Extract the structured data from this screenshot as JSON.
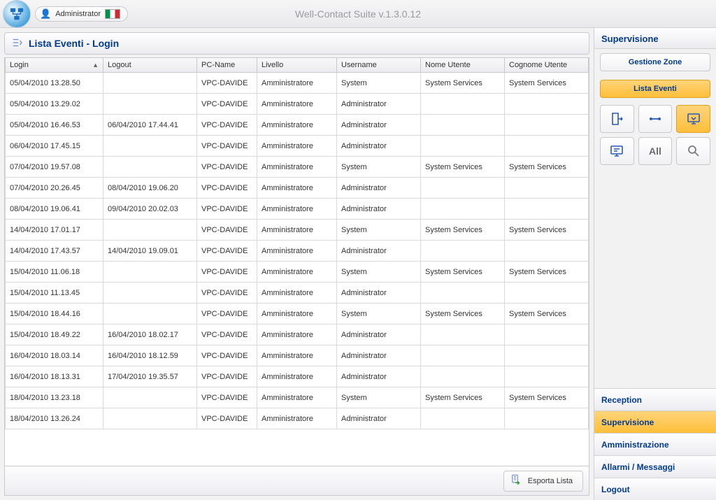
{
  "app": {
    "title": "Well-Contact Suite v.1.3.0.12",
    "user_role": "Administrator"
  },
  "page": {
    "title": "Lista Eventi - Login"
  },
  "table": {
    "columns": {
      "login": "Login",
      "logout": "Logout",
      "pcname": "PC-Name",
      "livello": "Livello",
      "username": "Username",
      "nome_utente": "Nome Utente",
      "cognome_utente": "Cognome Utente"
    },
    "sort_column": "Login",
    "rows": [
      {
        "login": "05/04/2010 13.28.50",
        "logout": "",
        "pcname": "VPC-DAVIDE",
        "livello": "Amministratore",
        "username": "System",
        "nome": "System Services",
        "cognome": "System Services"
      },
      {
        "login": "05/04/2010 13.29.02",
        "logout": "",
        "pcname": "VPC-DAVIDE",
        "livello": "Amministratore",
        "username": "Administrator",
        "nome": "",
        "cognome": ""
      },
      {
        "login": "05/04/2010 16.46.53",
        "logout": "06/04/2010 17.44.41",
        "pcname": "VPC-DAVIDE",
        "livello": "Amministratore",
        "username": "Administrator",
        "nome": "",
        "cognome": ""
      },
      {
        "login": "06/04/2010 17.45.15",
        "logout": "",
        "pcname": "VPC-DAVIDE",
        "livello": "Amministratore",
        "username": "Administrator",
        "nome": "",
        "cognome": ""
      },
      {
        "login": "07/04/2010 19.57.08",
        "logout": "",
        "pcname": "VPC-DAVIDE",
        "livello": "Amministratore",
        "username": "System",
        "nome": "System Services",
        "cognome": "System Services"
      },
      {
        "login": "07/04/2010 20.26.45",
        "logout": "08/04/2010 19.06.20",
        "pcname": "VPC-DAVIDE",
        "livello": "Amministratore",
        "username": "Administrator",
        "nome": "",
        "cognome": ""
      },
      {
        "login": "08/04/2010 19.06.41",
        "logout": "09/04/2010 20.02.03",
        "pcname": "VPC-DAVIDE",
        "livello": "Amministratore",
        "username": "Administrator",
        "nome": "",
        "cognome": ""
      },
      {
        "login": "14/04/2010 17.01.17",
        "logout": "",
        "pcname": "VPC-DAVIDE",
        "livello": "Amministratore",
        "username": "System",
        "nome": "System Services",
        "cognome": "System Services"
      },
      {
        "login": "14/04/2010 17.43.57",
        "logout": "14/04/2010 19.09.01",
        "pcname": "VPC-DAVIDE",
        "livello": "Amministratore",
        "username": "Administrator",
        "nome": "",
        "cognome": ""
      },
      {
        "login": "15/04/2010 11.06.18",
        "logout": "",
        "pcname": "VPC-DAVIDE",
        "livello": "Amministratore",
        "username": "System",
        "nome": "System Services",
        "cognome": "System Services"
      },
      {
        "login": "15/04/2010 11.13.45",
        "logout": "",
        "pcname": "VPC-DAVIDE",
        "livello": "Amministratore",
        "username": "Administrator",
        "nome": "",
        "cognome": ""
      },
      {
        "login": "15/04/2010 18.44.16",
        "logout": "",
        "pcname": "VPC-DAVIDE",
        "livello": "Amministratore",
        "username": "System",
        "nome": "System Services",
        "cognome": "System Services"
      },
      {
        "login": "15/04/2010 18.49.22",
        "logout": "16/04/2010 18.02.17",
        "pcname": "VPC-DAVIDE",
        "livello": "Amministratore",
        "username": "Administrator",
        "nome": "",
        "cognome": ""
      },
      {
        "login": "16/04/2010 18.03.14",
        "logout": "16/04/2010 18.12.59",
        "pcname": "VPC-DAVIDE",
        "livello": "Amministratore",
        "username": "Administrator",
        "nome": "",
        "cognome": ""
      },
      {
        "login": "16/04/2010 18.13.31",
        "logout": "17/04/2010 19.35.57",
        "pcname": "VPC-DAVIDE",
        "livello": "Amministratore",
        "username": "Administrator",
        "nome": "",
        "cognome": ""
      },
      {
        "login": "18/04/2010 13.23.18",
        "logout": "",
        "pcname": "VPC-DAVIDE",
        "livello": "Amministratore",
        "username": "System",
        "nome": "System Services",
        "cognome": "System Services"
      },
      {
        "login": "18/04/2010 13.26.24",
        "logout": "",
        "pcname": "VPC-DAVIDE",
        "livello": "Amministratore",
        "username": "Administrator",
        "nome": "",
        "cognome": ""
      }
    ]
  },
  "footer": {
    "export_label": "Esporta Lista"
  },
  "right": {
    "section_title": "Supervisione",
    "gestione_zone": "Gestione Zone",
    "lista_eventi": "Lista Eventi",
    "icon_tiles": {
      "access": "access-icon",
      "presence": "presence-icon",
      "login": "login-icon",
      "commands": "commands-icon",
      "all": "All",
      "search": "search-icon"
    },
    "nav": {
      "reception": "Reception",
      "supervisione": "Supervisione",
      "amministrazione": "Amministrazione",
      "allarmi": "Allarmi / Messaggi",
      "logout": "Logout"
    }
  }
}
